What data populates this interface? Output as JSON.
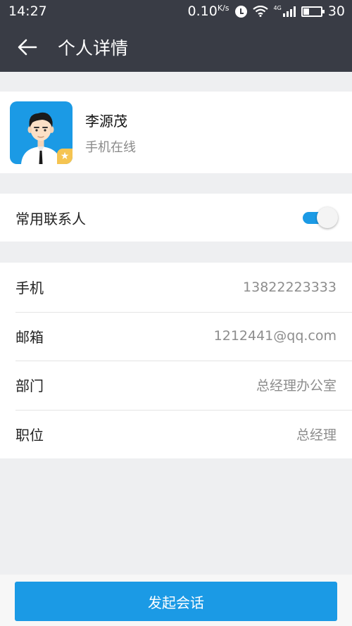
{
  "status_bar": {
    "time": "14:27",
    "network_speed": "0.10",
    "speed_unit": "K/s",
    "network_type": "4G",
    "battery_level": "30",
    "battery_fraction": 0.3
  },
  "toolbar": {
    "back_icon": "arrow-left-icon",
    "title": "个人详情"
  },
  "profile": {
    "name": "李源茂",
    "status": "手机在线",
    "avatar_color": "#1b9ae5",
    "badge_icon": "star-icon",
    "badge_color": "#f5c451"
  },
  "favorite": {
    "label": "常用联系人",
    "enabled": true,
    "accent_color": "#1b9ae5"
  },
  "details": [
    {
      "label": "手机",
      "value": "13822223333"
    },
    {
      "label": "邮箱",
      "value": "1212441@qq.com"
    },
    {
      "label": "部门",
      "value": "总经理办公室"
    },
    {
      "label": "职位",
      "value": "总经理"
    }
  ],
  "actions": {
    "start_chat_label": "发起会话"
  }
}
